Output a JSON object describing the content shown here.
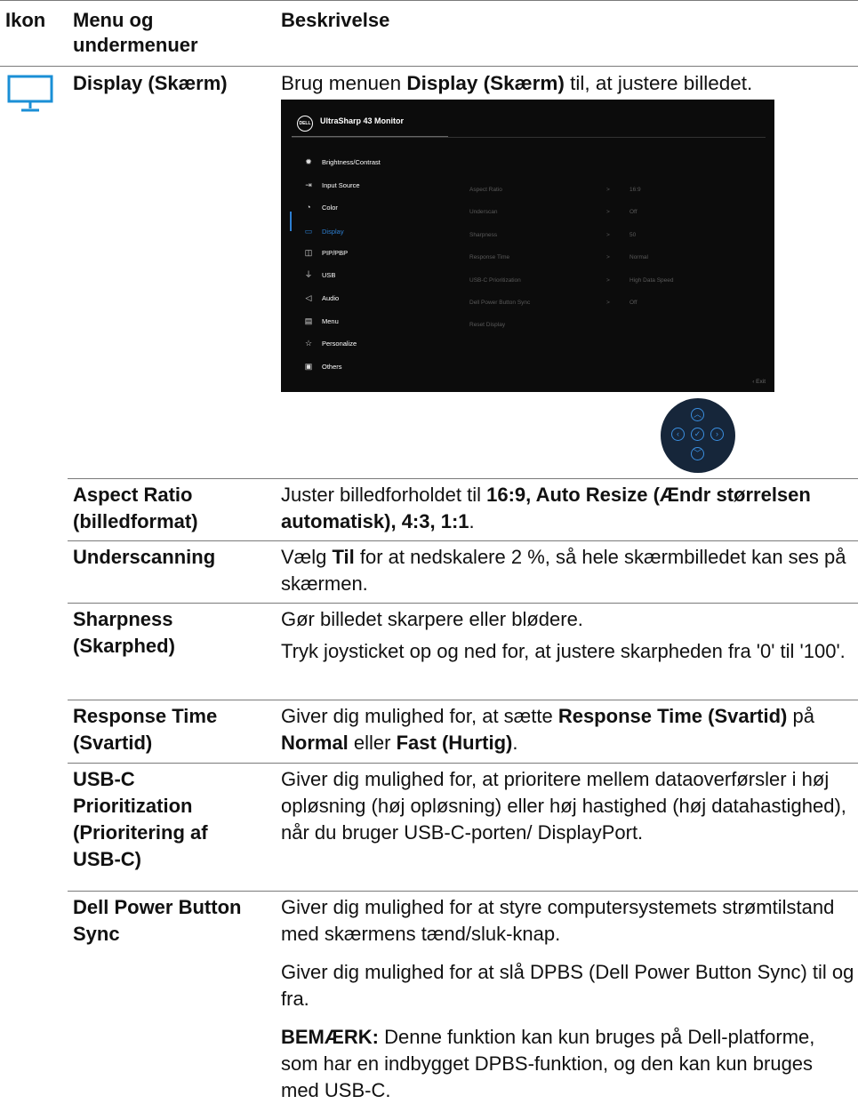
{
  "header": {
    "col_icon": "Ikon",
    "col_menu": "Menu og undermenuer",
    "col_desc": "Beskrivelse"
  },
  "display_row": {
    "icon": "monitor-icon",
    "name": "Display (Skærm)",
    "desc_pre": "Brug menuen ",
    "desc_bold": "Display (Skærm)",
    "desc_post": " til, at justere billedet."
  },
  "osd": {
    "brand": "DELL",
    "title": "UltraSharp 43 Monitor",
    "menu": [
      {
        "icon": "brightness-icon",
        "glyph": "✹",
        "label": "Brightness/Contrast"
      },
      {
        "icon": "input-source-icon",
        "glyph": "⇥",
        "label": "Input Source"
      },
      {
        "icon": "color-icon",
        "glyph": "◔",
        "label": "Color"
      },
      {
        "icon": "display-icon",
        "glyph": "▭",
        "label": "Display"
      },
      {
        "icon": "pip-pbp-icon",
        "glyph": "◫",
        "label": "PIP/PBP"
      },
      {
        "icon": "usb-icon",
        "glyph": "⏚",
        "label": "USB"
      },
      {
        "icon": "audio-icon",
        "glyph": "◁",
        "label": "Audio"
      },
      {
        "icon": "menu-icon",
        "glyph": "▤",
        "label": "Menu"
      },
      {
        "icon": "personalize-icon",
        "glyph": "☆",
        "label": "Personalize"
      },
      {
        "icon": "others-icon",
        "glyph": "▣",
        "label": "Others"
      }
    ],
    "active_item": "Display",
    "submenu": [
      {
        "label": "Aspect Ratio",
        "chevron": ">",
        "value": "16:9"
      },
      {
        "label": "Underscan",
        "chevron": ">",
        "value": "Off"
      },
      {
        "label": "Sharpness",
        "chevron": ">",
        "value": "50"
      },
      {
        "label": "Response Time",
        "chevron": ">",
        "value": "Normal"
      },
      {
        "label": "USB-C Prioritization",
        "chevron": ">",
        "value": "High Data Speed"
      },
      {
        "label": "Dell Power Button Sync",
        "chevron": ">",
        "value": "Off"
      },
      {
        "label": "Reset Display",
        "chevron": "",
        "value": ""
      }
    ],
    "exit_label": "‹  Exit"
  },
  "joystick": {
    "up": "︿",
    "down": "﹀",
    "left": "‹",
    "right": "›",
    "center": "✓"
  },
  "rows": {
    "aspect": {
      "name": "Aspect Ratio (billedformat)",
      "pre": "Juster billedforholdet til ",
      "bold": "16:9, Auto Resize (Ændr størrelsen automatisk), 4:3, 1:1",
      "post": "."
    },
    "underscan": {
      "name": "Underscanning",
      "pre": "Vælg ",
      "bold": "Til",
      "post": " for at nedskalere 2 %, så hele skærmbilledet kan ses på skærmen."
    },
    "sharpness": {
      "name": "Sharpness (Skarphed)",
      "p1": "Gør billedet skarpere eller blødere.",
      "p2": "Tryk joysticket op og ned for, at justere skarpheden fra '0' til '100'."
    },
    "response": {
      "name": "Response Time (Svartid)",
      "pre": "Giver dig mulighed for, at sætte ",
      "bold1": "Response Time (Svartid)",
      "mid1": " på ",
      "bold2": "Normal",
      "mid2": " eller ",
      "bold3": "Fast (Hurtig)",
      "post": "."
    },
    "usbc": {
      "name": "USB-C Prioritization (Prioritering af USB-C)",
      "desc": "Giver dig mulighed for, at prioritere mellem dataoverførsler i høj opløsning (høj opløsning) eller høj hastighed (høj datahastighed), når du bruger USB-C-porten/ DisplayPort."
    },
    "dpbs": {
      "name": "Dell Power Button Sync",
      "p1": "Giver dig mulighed for at styre computersystemets strømtilstand med skærmens tænd/sluk-knap.",
      "p2": "Giver dig mulighed for at slå DPBS (Dell Power Button Sync) til og fra.",
      "note_label": "BEMÆRK:",
      "note_text": " Denne funktion kan kun bruges på Dell-platforme, som har en indbygget DPBS-funktion, og den kan kun bruges med USB-C."
    }
  }
}
